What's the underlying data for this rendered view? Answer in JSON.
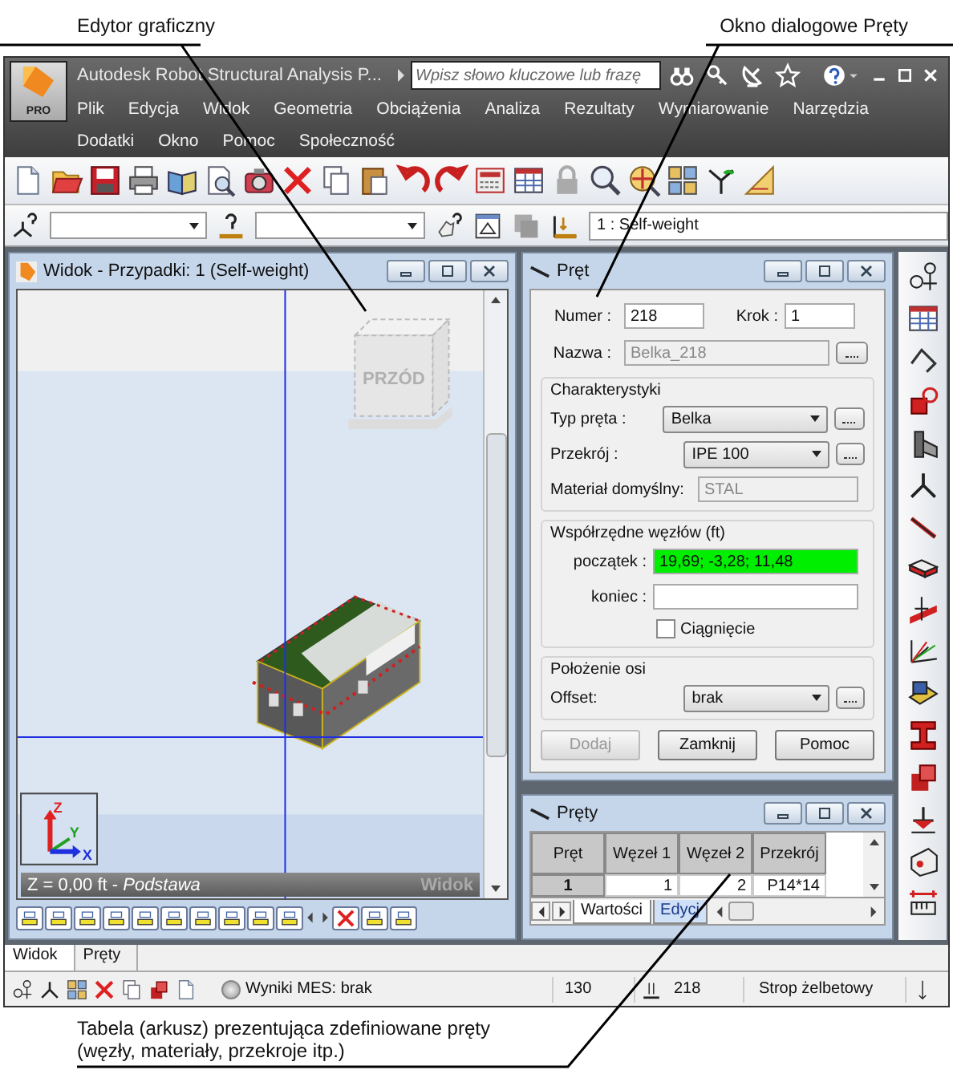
{
  "callouts": {
    "editor": "Edytor graficzny",
    "dialog": "Okno dialogowe Pręty",
    "table": "Tabela (arkusz) prezentująca zdefiniowane pręty\n(węzły, materiały, przekroje itp.)"
  },
  "app": {
    "logo_badge": "PRO",
    "title": "Autodesk Robot Structural Analysis P...",
    "search": {
      "placeholder": "Wpisz słowo kluczowe lub frazę"
    },
    "menu_rows": [
      {
        "items": [
          "Plik",
          "Edycja",
          "Widok",
          "Geometria",
          "Obciążenia",
          "Analiza",
          "Rezultaty",
          "Wymiarowanie",
          "Narzędzia"
        ]
      },
      {
        "items": [
          "Dodatki",
          "Okno",
          "Pomoc",
          "Społeczność"
        ]
      }
    ],
    "load_case": "1 : Self-weight"
  },
  "view": {
    "title": "Widok - Przypadki: 1 (Self-weight)",
    "cube_label": "PRZÓD",
    "axes": [
      "Z",
      "Y",
      "X"
    ],
    "status": "Z = 0,00 ft - *Podstawa*",
    "watermark": "Widok"
  },
  "dialog": {
    "title": "Pręt",
    "number": {
      "label": "Numer :",
      "value": "218"
    },
    "step": {
      "label": "Krok :",
      "value": "1"
    },
    "name": {
      "label": "Nazwa :",
      "value": "Belka_218",
      "disabled": true
    },
    "characteristics": {
      "title": "Charakterystyki",
      "bar_type": {
        "label": "Typ pręta :",
        "value": "Belka"
      },
      "section": {
        "label": "Przekrój :",
        "value": "IPE 100"
      },
      "material": {
        "label": "Materiał domyślny:",
        "value": "STAL",
        "disabled": true
      }
    },
    "coordinates": {
      "title": "Współrzędne węzłów (ft)",
      "start": {
        "label": "początek :",
        "value": "19,69; -3,28; 11,48",
        "highlighted": true
      },
      "end": {
        "label": "koniec :"
      },
      "drag": {
        "label": "Ciągnięcie",
        "checked": false
      }
    },
    "axis": {
      "title": "Położenie osi",
      "offset": {
        "label": "Offset:",
        "value": "brak"
      }
    },
    "buttons": [
      {
        "label": "Dodaj",
        "disabled": true
      },
      {
        "label": "Zamknij",
        "disabled": false
      },
      {
        "label": "Pomoc",
        "disabled": false
      }
    ]
  },
  "table": {
    "title": "Pręty",
    "columns": [
      "Pręt",
      "Węzeł 1",
      "Węzeł 2",
      "Przekrój"
    ],
    "rows": [
      {
        "cells": [
          "1",
          "1",
          "2",
          "P14*14"
        ]
      }
    ],
    "sheet_tabs": [
      {
        "label": "Wartości",
        "selected": false
      },
      {
        "label": "Edycj",
        "selected": true
      }
    ]
  },
  "bottom_tabs": [
    {
      "label": "Widok",
      "selected": true
    },
    {
      "label": "Pręty",
      "selected": false
    }
  ],
  "status_bar": {
    "results": "Wyniki MES: brak",
    "count": "130",
    "bar": "218",
    "section": "Strop żelbetowy"
  }
}
